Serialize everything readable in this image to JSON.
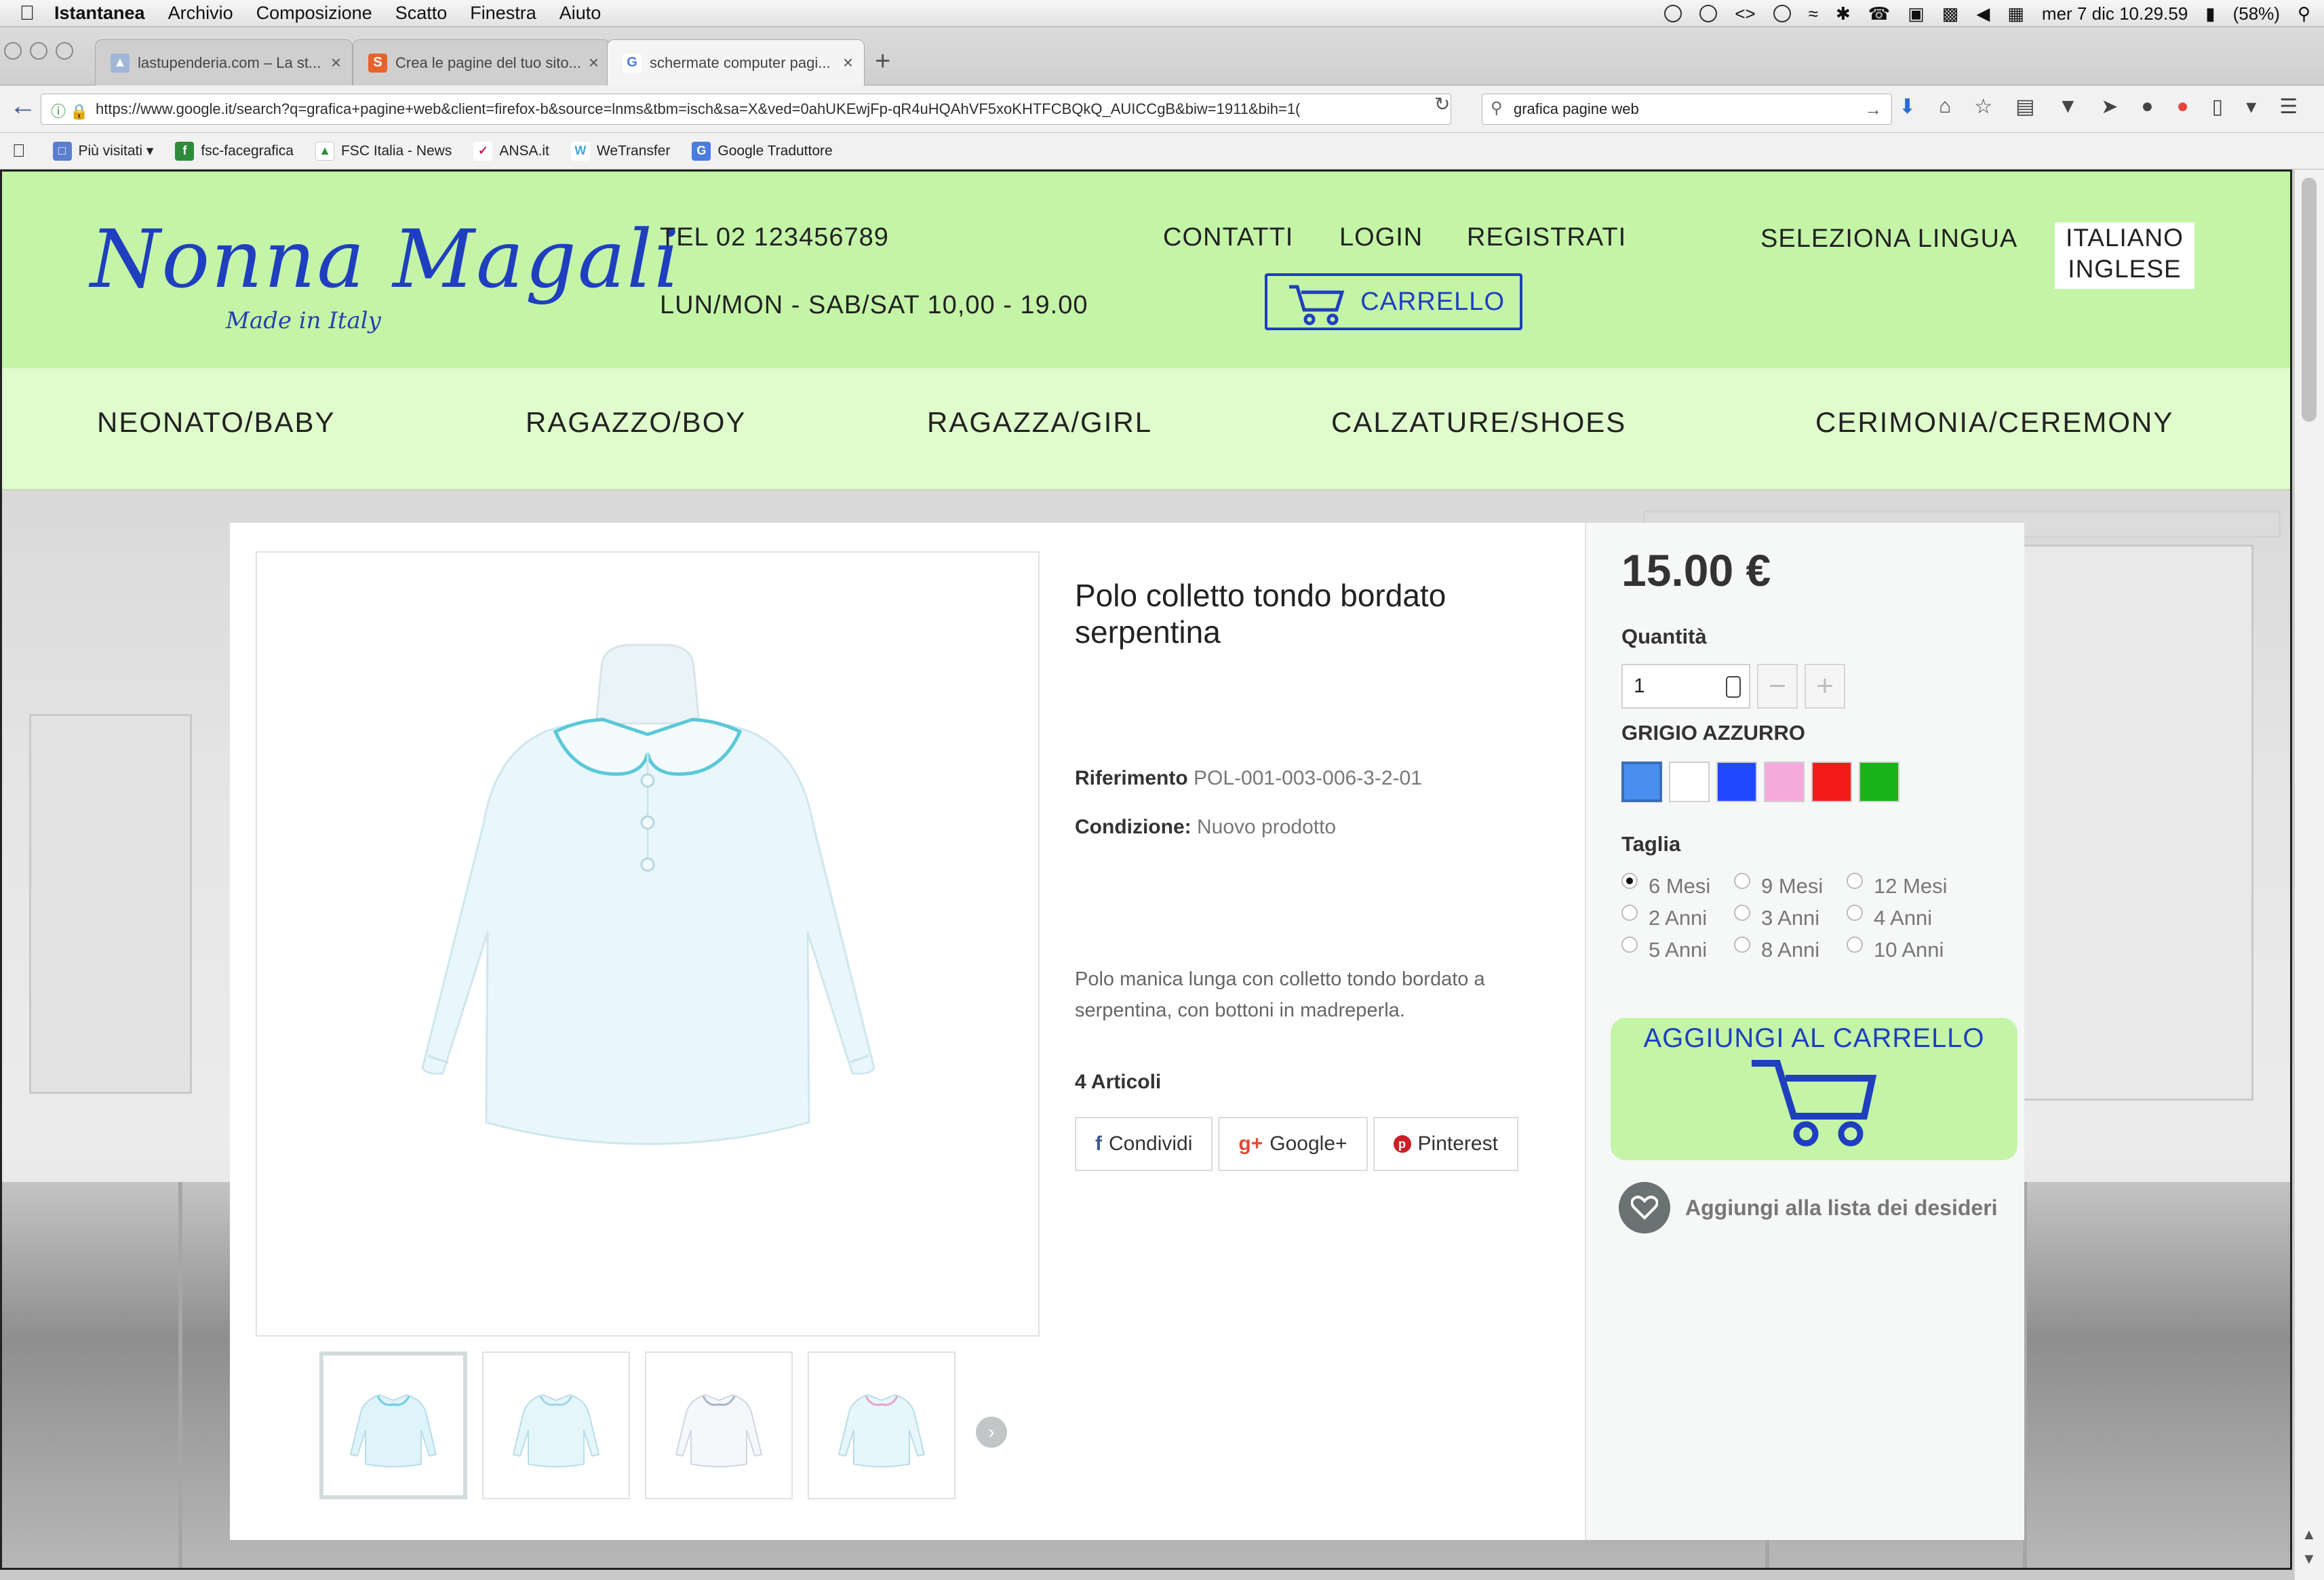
{
  "menubar": {
    "app": "Istantanea",
    "items": [
      "Archivio",
      "Composizione",
      "Scatto",
      "Finestra",
      "Aiuto"
    ],
    "clock": "mer 7 dic  10.29.59",
    "battery": "(58%)"
  },
  "browser": {
    "tabs": [
      {
        "title": "lastupenderia.com – La st...",
        "favicon_color": "#9fb6d6"
      },
      {
        "title": "Crea le pagine del tuo sito...",
        "favicon_color": "#e8632b"
      },
      {
        "title": "schermate computer pagi...",
        "favicon_color": "#4a7ce0"
      }
    ],
    "url": "https://www.google.it/search?q=grafica+pagine+web&client=firefox-b&source=lnms&tbm=isch&sa=X&ved=0ahUKEwjFp-qR4uHQAhVF5xoKHTFCBQkQ_AUICCgB&biw=1911&bih=1(",
    "search_query": "grafica pagine web",
    "bookmarks": [
      "Più visitati",
      "fsc-facegrafica",
      "FSC Italia - News",
      "ANSA.it",
      "WeTransfer",
      "Google Traduttore"
    ]
  },
  "site": {
    "logo": "Nonna Magali",
    "logo_sub": "Made in Italy",
    "phone": "TEL 02 123456789",
    "hours": "LUN/MON - SAB/SAT 10,00 - 19.00",
    "top_links": [
      "CONTATTI",
      "LOGIN",
      "REGISTRATI"
    ],
    "cart": "CARRELLO",
    "language_label": "SELEZIONA LINGUA",
    "languages": [
      "ITALIANO",
      "INGLESE"
    ],
    "nav": [
      "NEONATO/BABY",
      "RAGAZZO/BOY",
      "RAGAZZA/GIRL",
      "CALZATURE/SHOES",
      "CERIMONIA/CEREMONY"
    ],
    "brand_color": "#c4f5a7",
    "accent_color": "#1f3fbf"
  },
  "product": {
    "title": "Polo colletto tondo bordato serpentina",
    "ref_label": "Riferimento",
    "ref_value": "POL-001-003-006-3-2-01",
    "cond_label": "Condizione:",
    "cond_value": "Nuovo prodotto",
    "description": "Polo manica lunga con colletto tondo bordato a serpentina, con bottoni in madreperla.",
    "stock": "4 Articoli",
    "shares": [
      {
        "icon": "facebook-icon",
        "label": "Condividi",
        "color": "#3b5998"
      },
      {
        "icon": "google-plus-icon",
        "label": "Google+",
        "color": "#dd4b39"
      },
      {
        "icon": "pinterest-icon",
        "label": "Pinterest",
        "color": "#cb2027"
      }
    ],
    "price": "15.00 €",
    "qty_label": "Quantità",
    "qty_value": "1",
    "color_name": "GRIGIO AZZURRO",
    "colors": [
      "#4a8ff0",
      "#ffffff",
      "#1f48ff",
      "#f6a9dc",
      "#f21a1a",
      "#19b319"
    ],
    "selected_color": 0,
    "size_label": "Taglia",
    "sizes": [
      "6 Mesi",
      "9 Mesi",
      "12 Mesi",
      "2 Anni",
      "3 Anni",
      "4 Anni",
      "5 Anni",
      "8 Anni",
      "10 Anni"
    ],
    "selected_size": 0,
    "add_to_cart": "AGGIUNGI AL CARRELLO",
    "wishlist": "Aggiungi alla lista dei desideri",
    "thumbnail_count": 4
  }
}
